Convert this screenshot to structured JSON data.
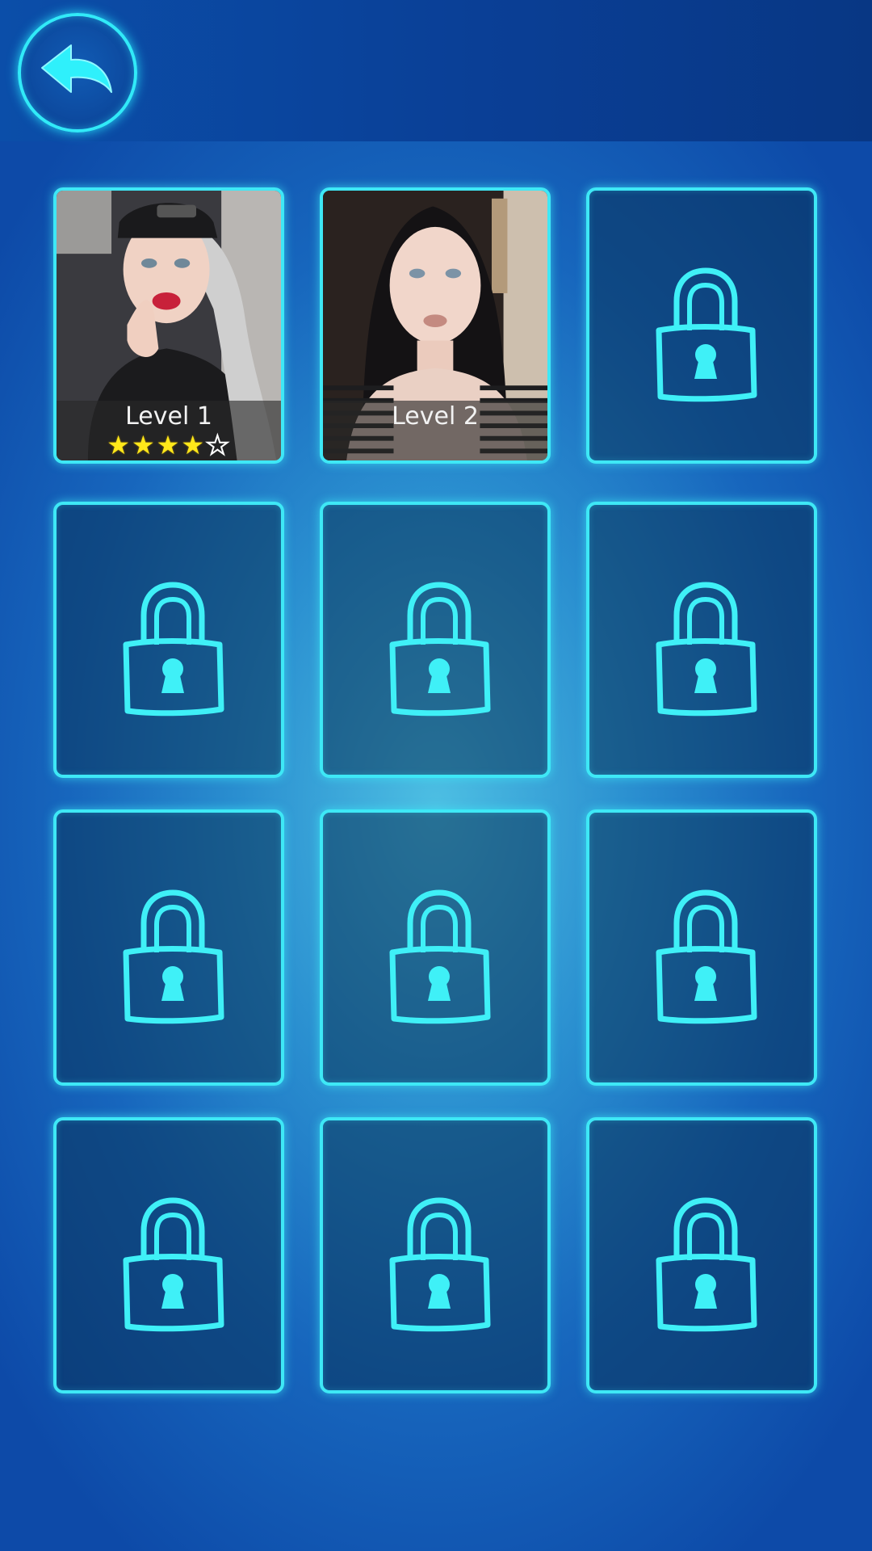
{
  "header": {
    "back_icon": "back-arrow-icon"
  },
  "colors": {
    "accent": "#3ee8f6",
    "star": "#ffe81a"
  },
  "levels": [
    {
      "label": "Level 1",
      "state": "unlocked",
      "stars": 4,
      "max_stars": 5
    },
    {
      "label": "Level 2",
      "state": "unlocked",
      "stars": 0,
      "max_stars": 5
    },
    {
      "label": "",
      "state": "locked",
      "icon": "lock-icon"
    },
    {
      "label": "",
      "state": "locked",
      "icon": "lock-icon"
    },
    {
      "label": "",
      "state": "locked",
      "icon": "lock-icon"
    },
    {
      "label": "",
      "state": "locked",
      "icon": "lock-icon"
    },
    {
      "label": "",
      "state": "locked",
      "icon": "lock-icon"
    },
    {
      "label": "",
      "state": "locked",
      "icon": "lock-icon"
    },
    {
      "label": "",
      "state": "locked",
      "icon": "lock-icon"
    },
    {
      "label": "",
      "state": "locked",
      "icon": "lock-icon"
    },
    {
      "label": "",
      "state": "locked",
      "icon": "lock-icon"
    },
    {
      "label": "",
      "state": "locked",
      "icon": "lock-icon"
    }
  ]
}
